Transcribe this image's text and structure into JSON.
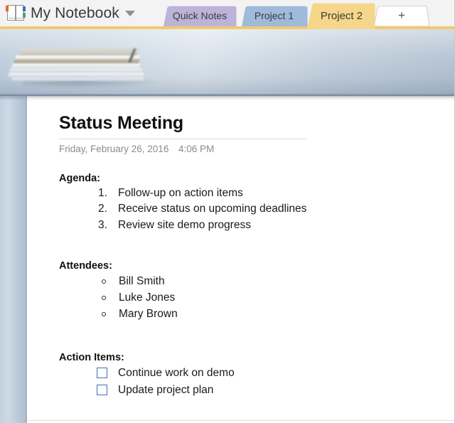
{
  "app": {
    "notebook_name": "My Notebook",
    "notebook_icon": "notebook-icon",
    "dropdown_icon": "chevron-down-icon"
  },
  "section_tabs": {
    "items": [
      {
        "label": "Quick Notes",
        "color": "#bdb3d9",
        "active": false
      },
      {
        "label": "Project 1",
        "color": "#9fbadb",
        "active": false
      },
      {
        "label": "Project 2",
        "color": "#f5d68a",
        "active": true
      }
    ],
    "add_tab_label": "+",
    "add_tab_icon": "plus-icon",
    "active_underline_color": "#f2ca6b"
  },
  "page": {
    "title": "Status Meeting",
    "date": "Friday, February 26, 2016",
    "time": "4:06 PM",
    "sections": {
      "agenda": {
        "heading": "Agenda:",
        "items": [
          "Follow-up on action items",
          "Receive status on upcoming deadlines",
          "Review site demo progress"
        ]
      },
      "attendees": {
        "heading": "Attendees:",
        "items": [
          "Bill Smith",
          "Luke Jones",
          "Mary Brown"
        ]
      },
      "action_items": {
        "heading": "Action Items:",
        "items": [
          {
            "label": "Continue work on demo",
            "checked": false
          },
          {
            "label": "Update project plan",
            "checked": false
          }
        ]
      }
    }
  },
  "colors": {
    "accent_gold": "#f2ca6b",
    "checkbox_border": "#4472a8",
    "meta_text": "#8b8b8b",
    "banner_base": "#c3d0dd"
  }
}
